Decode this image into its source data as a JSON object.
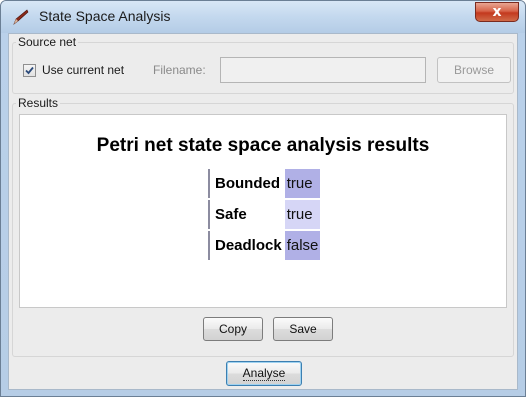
{
  "window": {
    "title": "State Space Analysis",
    "close_glyph": "x",
    "icon": "app-pen-icon"
  },
  "source": {
    "group_label": "Source net",
    "use_current_label": "Use current net",
    "use_current_checked": true,
    "filename_label": "Filename:",
    "filename_value": "",
    "browse_label": "Browse"
  },
  "results": {
    "group_label": "Results",
    "heading": "Petri net state space analysis results",
    "rows": [
      {
        "key": "Bounded",
        "value": "true",
        "color": "#b0b0e6"
      },
      {
        "key": "Safe",
        "value": "true",
        "color": "#d6d6f6"
      },
      {
        "key": "Deadlock",
        "value": "false",
        "color": "#b0b0e6"
      }
    ],
    "copy_label": "Copy",
    "save_label": "Save"
  },
  "analyse_label": "Analyse"
}
